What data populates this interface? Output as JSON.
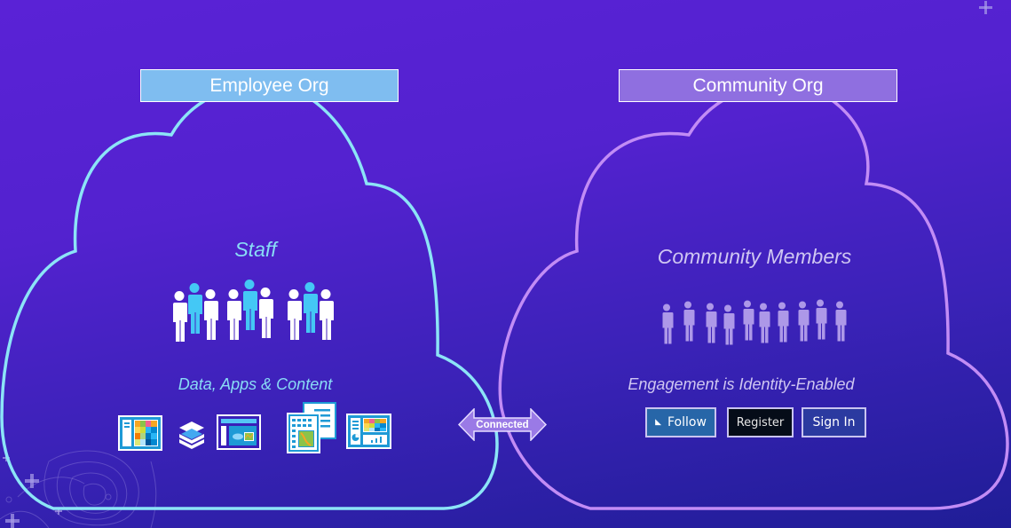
{
  "employee_org": {
    "label": "Employee Org",
    "heading": "Staff",
    "subheading": "Data, Apps & Content",
    "people_groups": 3,
    "people_per_group": 3,
    "content_icons": [
      "map-grid-app-icon",
      "layers-icon",
      "web-app-icon",
      "documents-table-icon",
      "dashboard-icon"
    ],
    "outline_color": "#8ce4f7",
    "label_bg": "#7fbdf0"
  },
  "connector": {
    "label": "Connected",
    "color": "#9a7ae6"
  },
  "community_org": {
    "label": "Community Org",
    "heading": "Community Members",
    "subheading": "Engagement is Identity-Enabled",
    "members_count": 10,
    "outline_color": "#c28cf5",
    "label_bg": "#8f6fe0",
    "buttons": {
      "follow": "Follow",
      "register": "Register",
      "sign_in": "Sign In"
    }
  },
  "colors": {
    "staff_white": "#ffffff",
    "staff_accent": "#44c8f5",
    "member": "#ad98e8"
  }
}
